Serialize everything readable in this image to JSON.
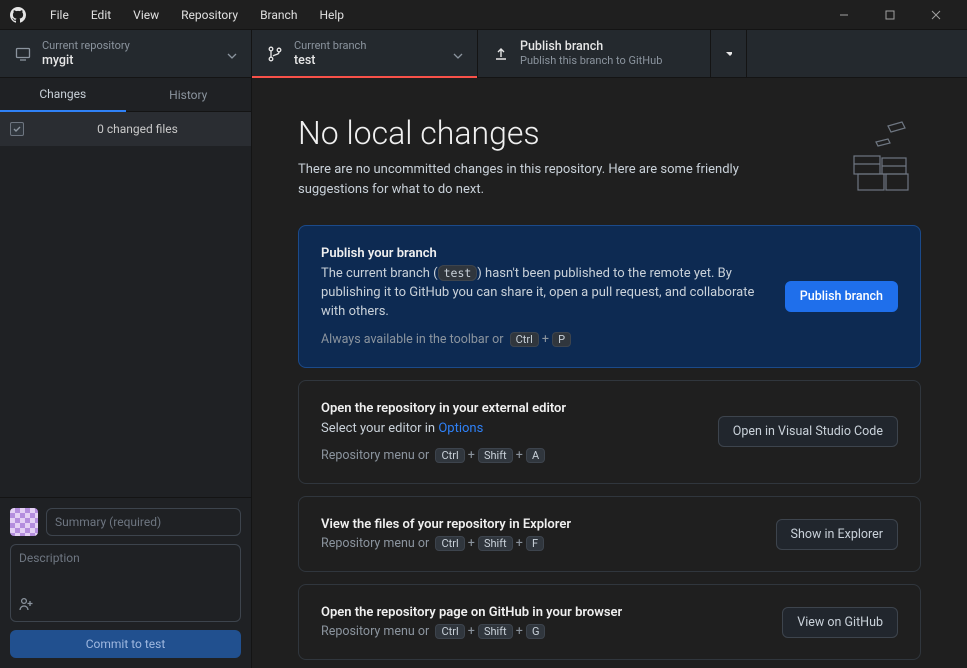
{
  "menu": {
    "file": "File",
    "edit": "Edit",
    "view": "View",
    "repository": "Repository",
    "branch": "Branch",
    "help": "Help"
  },
  "toolbar": {
    "repo_label": "Current repository",
    "repo_value": "mygit",
    "branch_label": "Current branch",
    "branch_value": "test",
    "publish_label": "Publish branch",
    "publish_sub": "Publish this branch to GitHub"
  },
  "sidebar": {
    "tabs": {
      "changes": "Changes",
      "history": "History"
    },
    "changes_count": "0 changed files",
    "summary_placeholder": "Summary (required)",
    "description_placeholder": "Description",
    "commit_btn": "Commit to test"
  },
  "main": {
    "heading": "No local changes",
    "subheading": "There are no uncommitted changes in this repository. Here are some friendly suggestions for what to do next.",
    "publish": {
      "title": "Publish your branch",
      "desc_before": "The current branch (",
      "desc_branch": "test",
      "desc_after": ") hasn't been published to the remote yet. By publishing it to GitHub you can share it, open a pull request, and collaborate with others.",
      "hint_before": "Always available in the toolbar or",
      "k1": "Ctrl",
      "k2": "P",
      "btn": "Publish branch"
    },
    "editor": {
      "title": "Open the repository in your external editor",
      "desc_before": "Select your editor in ",
      "link": "Options",
      "hint_before": "Repository menu or",
      "k1": "Ctrl",
      "k2": "Shift",
      "k3": "A",
      "btn": "Open in Visual Studio Code"
    },
    "explorer": {
      "title": "View the files of your repository in Explorer",
      "hint_before": "Repository menu or",
      "k1": "Ctrl",
      "k2": "Shift",
      "k3": "F",
      "btn": "Show in Explorer"
    },
    "github": {
      "title": "Open the repository page on GitHub in your browser",
      "hint_before": "Repository menu or",
      "k1": "Ctrl",
      "k2": "Shift",
      "k3": "G",
      "btn": "View on GitHub"
    }
  }
}
